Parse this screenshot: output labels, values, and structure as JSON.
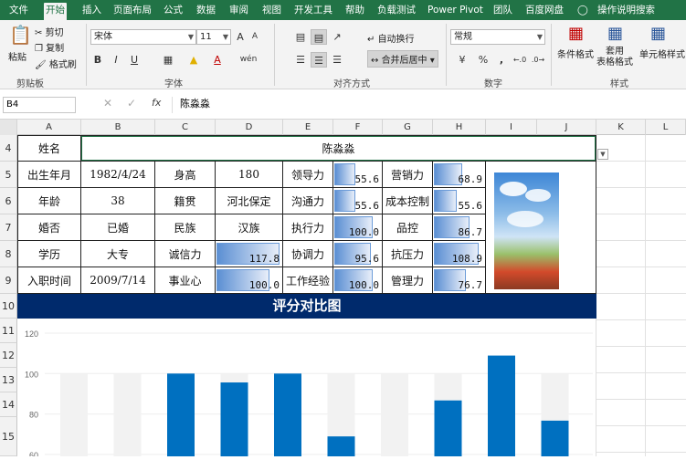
{
  "tabs": [
    "文件",
    "开始",
    "插入",
    "页面布局",
    "公式",
    "数据",
    "审阅",
    "视图",
    "开发工具",
    "帮助",
    "负载测试",
    "Power Pivot",
    "团队",
    "百度网盘",
    "操作说明搜索"
  ],
  "active_tab": "开始",
  "ribbon": {
    "clipboard": {
      "paste": "粘贴",
      "cut": "剪切",
      "copy": "复制",
      "format_painter": "格式刷",
      "label": "剪贴板"
    },
    "font": {
      "name": "宋体",
      "size": "11",
      "bold": "B",
      "italic": "I",
      "underline": "U",
      "grow": "A",
      "shrink": "A",
      "wen": "wén",
      "label": "字体"
    },
    "alignment": {
      "wrap": "自动换行",
      "merge": "合并后居中",
      "label": "对齐方式"
    },
    "number": {
      "format": "常规",
      "percent": "%",
      "comma": ",",
      "label": "数字"
    },
    "styles": {
      "conditional": "条件格式",
      "table": "套用\n表格格式",
      "cell": "单元格样式",
      "label": "样式"
    }
  },
  "formula_bar": {
    "name_box": "B4",
    "fx": "fx",
    "content": "陈淼淼"
  },
  "columns": [
    "A",
    "B",
    "C",
    "D",
    "E",
    "F",
    "G",
    "H",
    "I",
    "J",
    "K",
    "L"
  ],
  "rows": [
    "4",
    "5",
    "6",
    "7",
    "8",
    "9",
    "10",
    "11",
    "12",
    "13",
    "14",
    "15"
  ],
  "sheet": {
    "name_label": "姓名",
    "name_value": "陈淼淼",
    "grid": [
      [
        "出生年月",
        "1982/4/24",
        "身高",
        "180",
        "领导力",
        "55.6",
        "营销力",
        "68.9"
      ],
      [
        "年龄",
        "38",
        "籍贯",
        "河北保定",
        "沟通力",
        "55.6",
        "成本控制",
        "55.6"
      ],
      [
        "婚否",
        "已婚",
        "民族",
        "汉族",
        "执行力",
        "100.0",
        "品控",
        "86.7"
      ],
      [
        "学历",
        "大专",
        "诚信力",
        "117.8",
        "协调力",
        "95.6",
        "抗压力",
        "108.9"
      ],
      [
        "入职时间",
        "2009/7/14",
        "事业心",
        "100.0",
        "工作经验",
        "100.0",
        "管理力",
        "76.7"
      ]
    ],
    "banner": "评分对比图"
  },
  "chart_data": {
    "type": "bar",
    "yticks": [
      "120",
      "100",
      "80",
      "60"
    ],
    "ylim": [
      50,
      120
    ],
    "values": [
      55.6,
      55.6,
      100.0,
      95.6,
      100.0,
      68.9,
      55.6,
      86.7,
      108.9,
      76.7
    ],
    "background_values": [
      100,
      100,
      100,
      100,
      100,
      100,
      100,
      100,
      100,
      100
    ],
    "colors": {
      "bar": "#0070c0",
      "track": "#f2f2f2"
    }
  }
}
